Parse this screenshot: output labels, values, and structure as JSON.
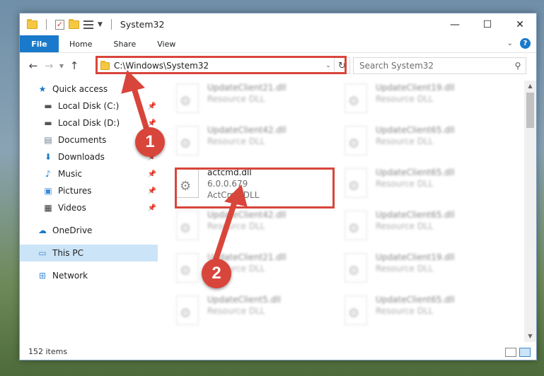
{
  "window": {
    "title": "System32",
    "controls": {
      "minimize": "—",
      "maximize": "☐",
      "close": "✕"
    }
  },
  "ribbon": {
    "file_tab": "File",
    "tabs": [
      "Home",
      "Share",
      "View"
    ]
  },
  "nav": {
    "address": "C:\\Windows\\System32",
    "search_placeholder": "Search System32"
  },
  "sidebar": {
    "quick_access": "Quick access",
    "items": [
      {
        "label": "Local Disk (C:)",
        "pinned": true
      },
      {
        "label": "Local Disk (D:)",
        "pinned": true
      },
      {
        "label": "Documents",
        "pinned": true
      },
      {
        "label": "Downloads",
        "pinned": true
      },
      {
        "label": "Music",
        "pinned": true
      },
      {
        "label": "Pictures",
        "pinned": true
      },
      {
        "label": "Videos",
        "pinned": true
      }
    ],
    "onedrive": "OneDrive",
    "this_pc": "This PC",
    "network": "Network"
  },
  "files": {
    "left": [
      {
        "name": "UpdateClient21.dll",
        "sub": "Resource DLL"
      },
      {
        "name": "UpdateClient42.dll",
        "sub": "Resource DLL"
      },
      {
        "name": "actcmd.dll",
        "version": "6.0.0.679",
        "sub": "ActCmd DLL"
      },
      {
        "name": "UpdateClient42.dll",
        "sub": "Resource DLL"
      },
      {
        "name": "UpdateClient21.dll",
        "sub": "Resource DLL"
      },
      {
        "name": "UpdateClient5.dll",
        "sub": "Resource DLL"
      }
    ],
    "right": [
      {
        "name": "UpdateClient19.dll",
        "sub": "Resource DLL"
      },
      {
        "name": "UpdateClient65.dll",
        "sub": "Resource DLL"
      },
      {
        "name": "UpdateClient65.dll",
        "sub": "Resource DLL"
      },
      {
        "name": "UpdateClient65.dll",
        "sub": "Resource DLL"
      },
      {
        "name": "UpdateClient19.dll",
        "sub": "Resource DLL"
      },
      {
        "name": "UpdateClient65.dll",
        "sub": "Resource DLL"
      }
    ]
  },
  "status": {
    "item_count": "152 items"
  },
  "callouts": {
    "one": "1",
    "two": "2"
  },
  "colors": {
    "accent": "#1979ca",
    "annotation": "#d8453b",
    "selection": "#cce4f7"
  }
}
